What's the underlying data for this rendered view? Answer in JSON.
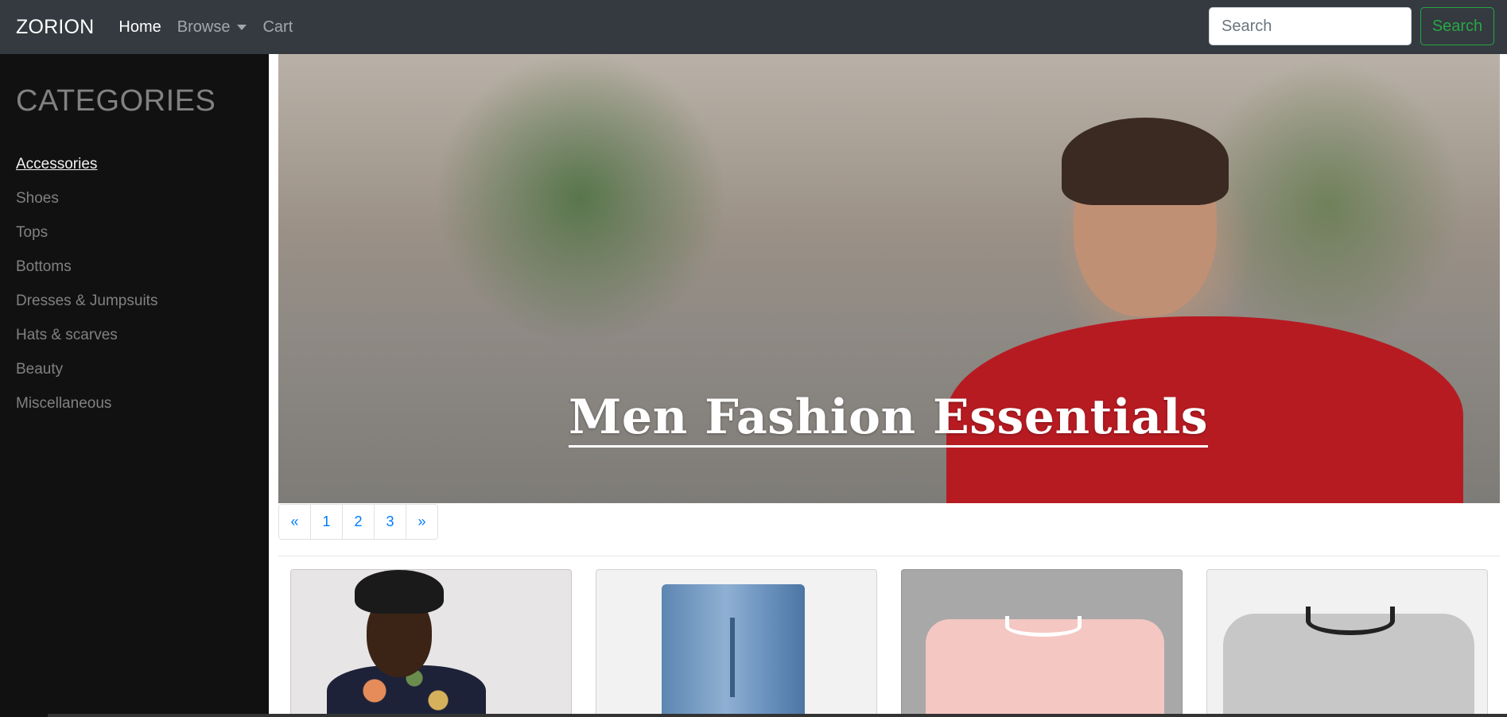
{
  "navbar": {
    "brand": "ZORION",
    "links": [
      {
        "label": "Home"
      },
      {
        "label": "Browse"
      },
      {
        "label": "Cart"
      }
    ],
    "search": {
      "placeholder": "Search",
      "button_label": "Search"
    },
    "colors": {
      "background": "#343a40",
      "search_accent": "#28a745"
    }
  },
  "sidebar": {
    "heading": "CATEGORIES",
    "items": [
      {
        "label": "Accessories"
      },
      {
        "label": "Shoes"
      },
      {
        "label": "Tops"
      },
      {
        "label": "Bottoms"
      },
      {
        "label": "Dresses & Jumpsuits"
      },
      {
        "label": "Hats & scarves"
      },
      {
        "label": "Beauty"
      },
      {
        "label": "Miscellaneous"
      }
    ]
  },
  "hero": {
    "title": "Men Fashion Essentials"
  },
  "pagination": {
    "prev": "«",
    "pages": [
      "1",
      "2",
      "3"
    ],
    "next": "»",
    "link_color": "#007bff"
  }
}
